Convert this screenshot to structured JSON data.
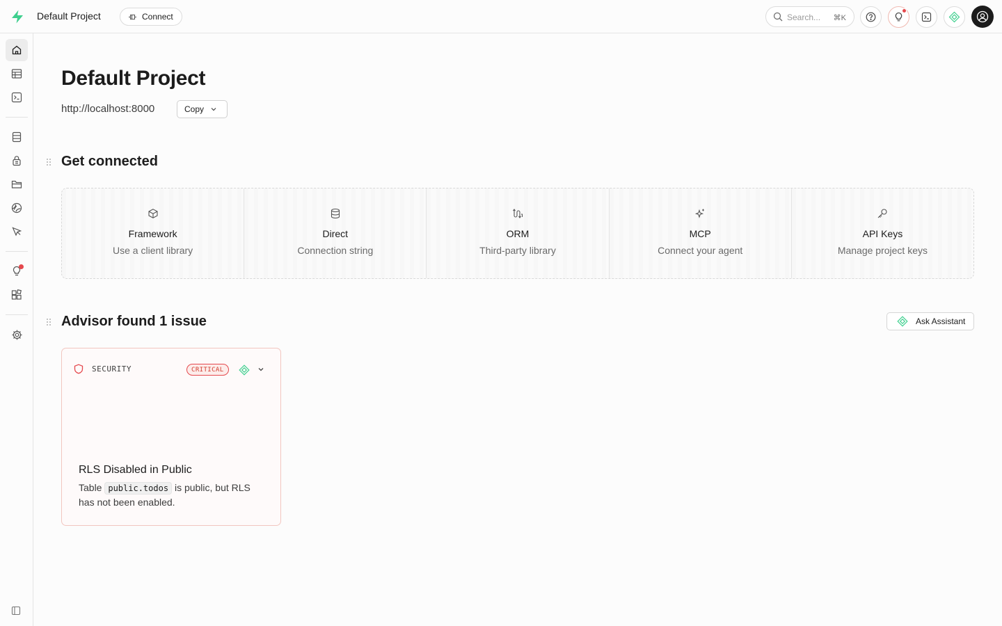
{
  "header": {
    "project_name": "Default Project",
    "connect_label": "Connect",
    "search": {
      "placeholder": "Search...",
      "shortcut": "⌘K"
    },
    "actions": [
      "help-icon",
      "advisor-icon",
      "terminal-icon",
      "assistant-icon",
      "avatar"
    ]
  },
  "sidebar": {
    "items": [
      {
        "name": "home",
        "icon": "home-icon",
        "active": true
      },
      {
        "name": "table-editor",
        "icon": "table-icon"
      },
      {
        "name": "sql-editor",
        "icon": "terminal-icon"
      },
      {
        "name": "database",
        "icon": "database-icon"
      },
      {
        "name": "authentication",
        "icon": "lock-icon"
      },
      {
        "name": "storage",
        "icon": "folder-icon"
      },
      {
        "name": "realtime",
        "icon": "realtime-icon"
      },
      {
        "name": "edge-functions",
        "icon": "cursor-icon"
      },
      {
        "name": "advisors",
        "icon": "lightbulb-icon",
        "has_notification": true
      },
      {
        "name": "integrations",
        "icon": "integrations-icon"
      },
      {
        "name": "settings",
        "icon": "gear-icon"
      }
    ]
  },
  "main": {
    "title": "Default Project",
    "url": "http://localhost:8000",
    "copy_label": "Copy",
    "get_connected": {
      "title": "Get connected",
      "cards": [
        {
          "title": "Framework",
          "subtitle": "Use a client library",
          "icon": "box-icon"
        },
        {
          "title": "Direct",
          "subtitle": "Connection string",
          "icon": "database-icon"
        },
        {
          "title": "ORM",
          "subtitle": "Third-party library",
          "icon": "orm-icon"
        },
        {
          "title": "MCP",
          "subtitle": "Connect your agent",
          "icon": "sparkles-icon"
        },
        {
          "title": "API Keys",
          "subtitle": "Manage project keys",
          "icon": "key-icon"
        }
      ]
    },
    "advisor": {
      "title": "Advisor found 1 issue",
      "ask_label": "Ask Assistant",
      "issue": {
        "category": "SECURITY",
        "severity": "CRITICAL",
        "title": "RLS Disabled in Public",
        "desc_before": "Table",
        "desc_code": "public.todos",
        "desc_after": "is public, but RLS has not been enabled."
      }
    }
  },
  "colors": {
    "accent": "#3ecf8e",
    "critical": "#e5484d",
    "border": "#e4e4e4",
    "text": "#1c1c1c"
  }
}
